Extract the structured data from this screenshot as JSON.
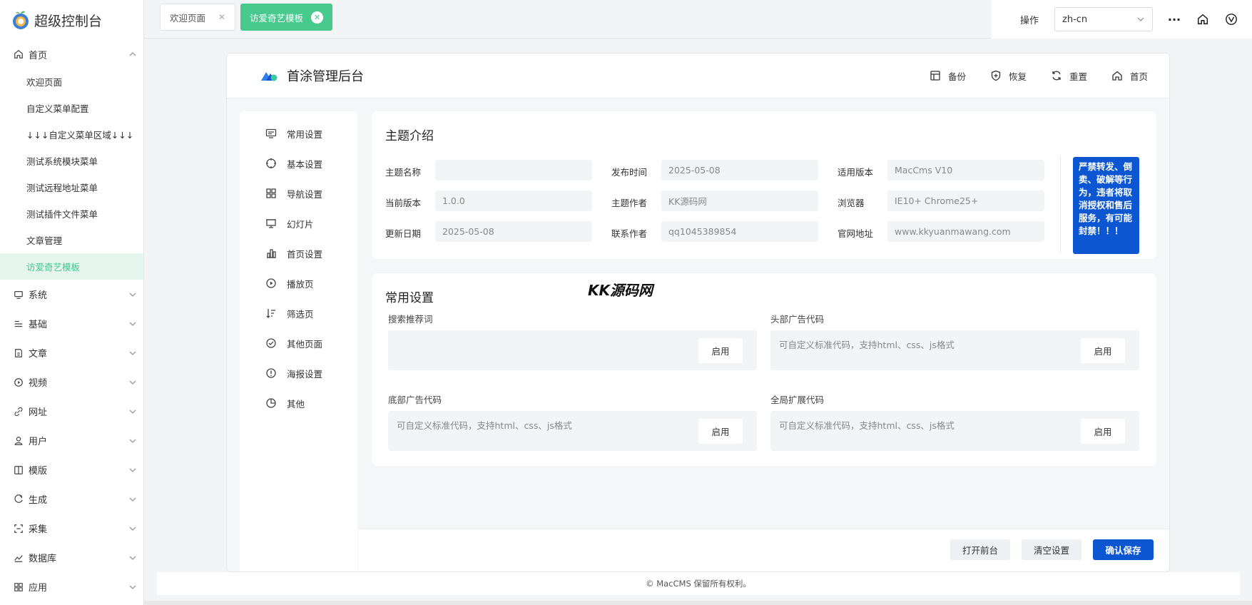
{
  "sidebar": {
    "logo_text": "超级控制台",
    "home_group": "首页",
    "sub_items": [
      "欢迎页面",
      "自定义菜单配置",
      "↓↓↓自定义菜单区域↓↓↓",
      "测试系统模块菜单",
      "测试远程地址菜单",
      "测试插件文件菜单",
      "文章管理",
      "访爱奇艺模板"
    ],
    "groups": [
      "系统",
      "基础",
      "文章",
      "视频",
      "网址",
      "用户",
      "模版",
      "生成",
      "采集",
      "数据库",
      "应用"
    ]
  },
  "tabs": [
    {
      "label": "欢迎页面",
      "close": "✕"
    },
    {
      "label": "访爱奇艺模板",
      "close": "✕"
    }
  ],
  "topbar": {
    "op_label": "操作",
    "lang": "zh-cn",
    "more": "···"
  },
  "card": {
    "title": "首涂管理后台",
    "actions": [
      "备份",
      "恢复",
      "重置",
      "首页"
    ]
  },
  "settings_menu": [
    "常用设置",
    "基本设置",
    "导航设置",
    "幻灯片",
    "首页设置",
    "播放页",
    "筛选页",
    "其他页面",
    "海报设置",
    "其他"
  ],
  "intro": {
    "title": "主题介绍",
    "fields": [
      {
        "label": "主题名称",
        "value": ""
      },
      {
        "label": "发布时间",
        "value": "2025-05-08"
      },
      {
        "label": "适用版本",
        "value": "MacCms V10"
      },
      {
        "label": "当前版本",
        "value": "1.0.0"
      },
      {
        "label": "主题作者",
        "value": "KK源码网"
      },
      {
        "label": "浏览器",
        "value": "IE10+ Chrome25+"
      },
      {
        "label": "更新日期",
        "value": "2025-05-08"
      },
      {
        "label": "联系作者",
        "value": "qq1045389854"
      },
      {
        "label": "官网地址",
        "value": "www.kkyuanmawang.com"
      }
    ],
    "notice": "严禁转发、倒卖、破解等行为，违者将取消授权和售后服务，有可能封禁！！！"
  },
  "common": {
    "title": "常用设置",
    "watermark": "KK源码网",
    "blocks": [
      {
        "label": "搜索推荐词",
        "placeholder": "",
        "button": "启用"
      },
      {
        "label": "头部广告代码",
        "placeholder": "可自定义标准代码，支持html、css、js格式",
        "button": "启用"
      },
      {
        "label": "底部广告代码",
        "placeholder": "可自定义标准代码，支持html、css、js格式",
        "button": "启用"
      },
      {
        "label": "全局扩展代码",
        "placeholder": "可自定义标准代码，支持html、css、js格式",
        "button": "启用"
      }
    ]
  },
  "footer": {
    "open_front": "打开前台",
    "clear": "清空设置",
    "save": "确认保存",
    "copyright": "© MacCMS 保留所有权利。"
  },
  "colors": {
    "accent_green": "#48c98e",
    "primary_blue": "#0c57d1"
  }
}
